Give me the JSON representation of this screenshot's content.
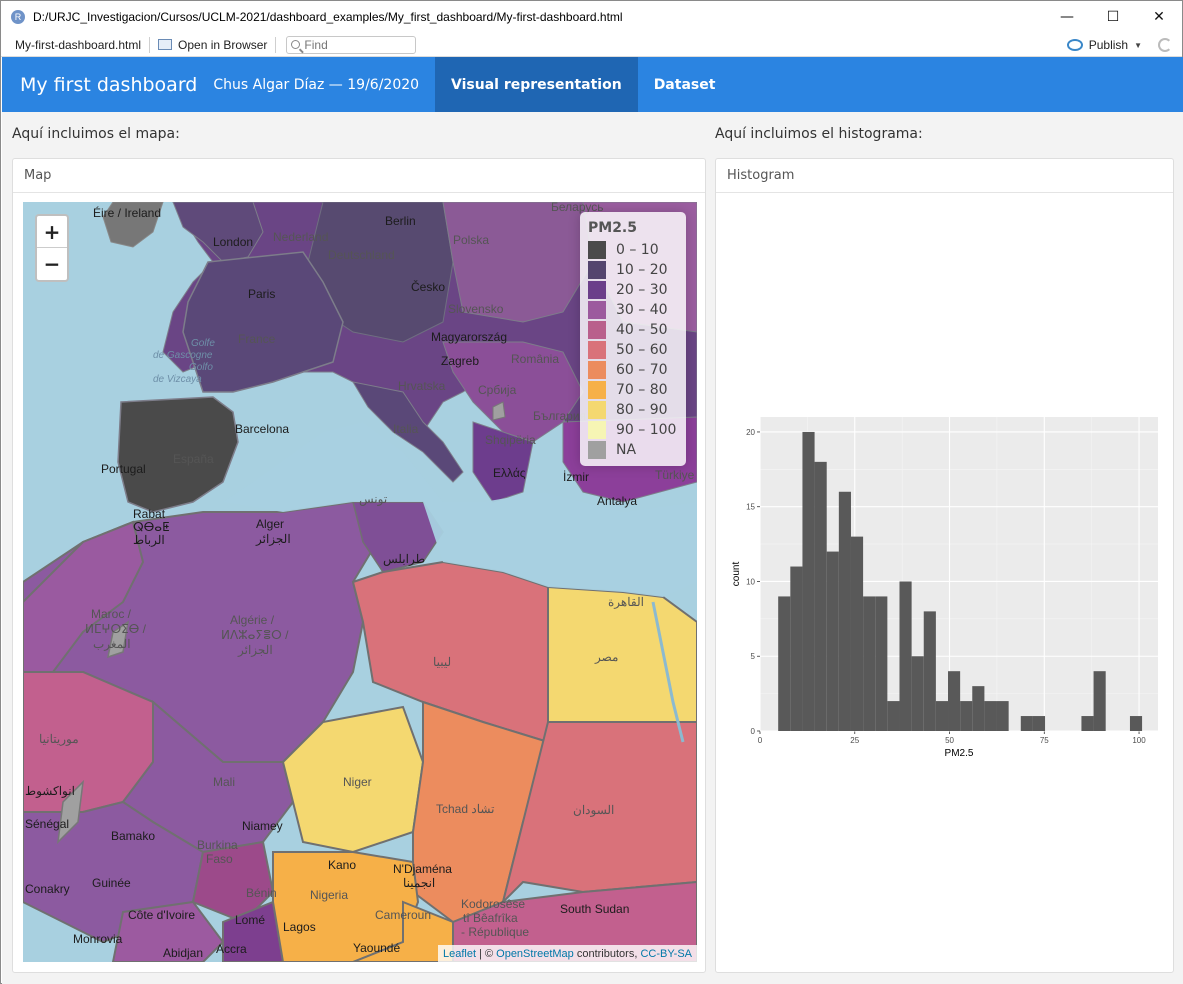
{
  "window": {
    "app_icon": "R",
    "title": "D:/URJC_Investigacion/Cursos/UCLM-2021/dashboard_examples/My_first_dashboard/My-first-dashboard.html",
    "minimize_icon": "minimize-icon",
    "maximize_icon": "maximize-icon",
    "close_icon": "close-icon"
  },
  "toolbar": {
    "file_label": "My-first-dashboard.html",
    "open_browser_label": "Open in Browser",
    "find_placeholder": "Find",
    "publish_label": "Publish"
  },
  "navbar": {
    "title": "My first dashboard",
    "author": "Chus Algar Díaz — 19/6/2020",
    "tabs": [
      {
        "label": "Visual representation",
        "active": true
      },
      {
        "label": "Dataset",
        "active": false
      }
    ],
    "color": "#2b84e1",
    "active_color": "#1f66b3"
  },
  "left_column": {
    "heading": "Aquí incluimos el mapa:",
    "card_title": "Map"
  },
  "right_column": {
    "heading": "Aquí incluimos el histograma:",
    "card_title": "Histogram"
  },
  "map": {
    "zoom_in": "+",
    "zoom_out": "−",
    "legend": {
      "title": "PM2.5",
      "items": [
        {
          "label": "0 – 10",
          "color": "#4a4a4a"
        },
        {
          "label": "10 – 20",
          "color": "#54456e"
        },
        {
          "label": "20 – 30",
          "color": "#6b3f8a"
        },
        {
          "label": "30 – 40",
          "color": "#9c5a9e"
        },
        {
          "label": "40 – 50",
          "color": "#b9608c"
        },
        {
          "label": "50 – 60",
          "color": "#d9727a"
        },
        {
          "label": "60 – 70",
          "color": "#ec8c5e"
        },
        {
          "label": "70 – 80",
          "color": "#f6b048"
        },
        {
          "label": "80 – 90",
          "color": "#f4d870"
        },
        {
          "label": "90 – 100",
          "color": "#f6f5b4"
        },
        {
          "label": "NA",
          "color": "#a0a0a0"
        }
      ]
    },
    "labels": [
      {
        "text": "Éire / Ireland"
      },
      {
        "text": "London"
      },
      {
        "text": "Nederland"
      },
      {
        "text": "Berlin"
      },
      {
        "text": "Deutschland"
      },
      {
        "text": "Polska"
      },
      {
        "text": "Беларусь"
      },
      {
        "text": "Paris"
      },
      {
        "text": "Česko"
      },
      {
        "text": "France"
      },
      {
        "text": "Slovensko"
      },
      {
        "text": "Magyarország"
      },
      {
        "text": "Zagreb"
      },
      {
        "text": "România"
      },
      {
        "text": "Hrvatska"
      },
      {
        "text": "Србија"
      },
      {
        "text": "България"
      },
      {
        "text": "Italia"
      },
      {
        "text": "Barcelona"
      },
      {
        "text": "España"
      },
      {
        "text": "Portugal"
      },
      {
        "text": "Shqipëria"
      },
      {
        "text": "Ελλάς"
      },
      {
        "text": "İzmir"
      },
      {
        "text": "Türkiye"
      },
      {
        "text": "Antalya"
      },
      {
        "text": "Rabat"
      },
      {
        "text": "ⵕⴱⴰⵟ"
      },
      {
        "text": "الرباط"
      },
      {
        "text": "Alger"
      },
      {
        "text": "الجزائر"
      },
      {
        "text": "تونس"
      },
      {
        "text": "طرابلس"
      },
      {
        "text": "القاهرة"
      },
      {
        "text": "مصر"
      },
      {
        "text": "Maroc /"
      },
      {
        "text": "ⵍⵎⵖⵔⵉⴱ /"
      },
      {
        "text": "المغرب"
      },
      {
        "text": "Algérie /"
      },
      {
        "text": "ⵍⴷⵣⴰⵢⴻⵔ /"
      },
      {
        "text": "الجزائر"
      },
      {
        "text": "ليبيا"
      },
      {
        "text": "موريتانيا"
      },
      {
        "text": "Mali"
      },
      {
        "text": "Niger"
      },
      {
        "text": "Tchad تشاد"
      },
      {
        "text": "السودان"
      },
      {
        "text": "انواكشوط"
      },
      {
        "text": "Sénégal"
      },
      {
        "text": "Bamako"
      },
      {
        "text": "Niamey"
      },
      {
        "text": "Burkina"
      },
      {
        "text": "Faso"
      },
      {
        "text": "Kano"
      },
      {
        "text": "N'Djaména"
      },
      {
        "text": "انجمينا"
      },
      {
        "text": "Nigeria"
      },
      {
        "text": "Guinée"
      },
      {
        "text": "Bénin"
      },
      {
        "text": "Conakry"
      },
      {
        "text": "Côte d'Ivoire"
      },
      {
        "text": "Lomé"
      },
      {
        "text": "Cameroun"
      },
      {
        "text": "Monrovia"
      },
      {
        "text": "Lagos"
      },
      {
        "text": "Abidjan"
      },
      {
        "text": "Accra"
      },
      {
        "text": "Yaoundé"
      },
      {
        "text": "Kodorosêse"
      },
      {
        "text": "tî Bêafrîka"
      },
      {
        "text": "- République"
      },
      {
        "text": "South Sudan"
      },
      {
        "text": "Golfe"
      },
      {
        "text": "de Gascogne"
      },
      {
        "text": "Golfo"
      },
      {
        "text": "de Vizcaya"
      }
    ],
    "attribution": {
      "leaflet": "Leaflet",
      "sep": " | © ",
      "osm": "OpenStreetMap",
      "contrib": " contributors, ",
      "license": "CC-BY-SA"
    }
  },
  "chart_data": {
    "type": "bar",
    "title": "",
    "xlabel": "PM2.5",
    "ylabel": "count",
    "xlim": [
      0,
      105
    ],
    "ylim": [
      0,
      21
    ],
    "x_ticks": [
      0,
      25,
      50,
      75,
      100
    ],
    "y_ticks": [
      0,
      5,
      10,
      15,
      20
    ],
    "bin_width": 3.2,
    "bins": [
      {
        "x0": 4.8,
        "count": 9
      },
      {
        "x0": 8.0,
        "count": 11
      },
      {
        "x0": 11.2,
        "count": 20
      },
      {
        "x0": 14.4,
        "count": 18
      },
      {
        "x0": 17.6,
        "count": 12
      },
      {
        "x0": 20.8,
        "count": 16
      },
      {
        "x0": 24.0,
        "count": 13
      },
      {
        "x0": 27.2,
        "count": 9
      },
      {
        "x0": 30.4,
        "count": 9
      },
      {
        "x0": 33.6,
        "count": 2
      },
      {
        "x0": 36.8,
        "count": 10
      },
      {
        "x0": 40.0,
        "count": 5
      },
      {
        "x0": 43.2,
        "count": 8
      },
      {
        "x0": 46.4,
        "count": 2
      },
      {
        "x0": 49.6,
        "count": 4
      },
      {
        "x0": 52.8,
        "count": 2
      },
      {
        "x0": 56.0,
        "count": 3
      },
      {
        "x0": 59.2,
        "count": 2
      },
      {
        "x0": 62.4,
        "count": 2
      },
      {
        "x0": 65.6,
        "count": 0
      },
      {
        "x0": 68.8,
        "count": 1
      },
      {
        "x0": 72.0,
        "count": 1
      },
      {
        "x0": 75.2,
        "count": 0
      },
      {
        "x0": 78.4,
        "count": 0
      },
      {
        "x0": 81.6,
        "count": 0
      },
      {
        "x0": 84.8,
        "count": 1
      },
      {
        "x0": 88.0,
        "count": 4
      },
      {
        "x0": 91.2,
        "count": 0
      },
      {
        "x0": 94.4,
        "count": 0
      },
      {
        "x0": 97.6,
        "count": 1
      }
    ],
    "bar_color": "#595959",
    "panel_color": "#ebebeb",
    "grid": true
  }
}
